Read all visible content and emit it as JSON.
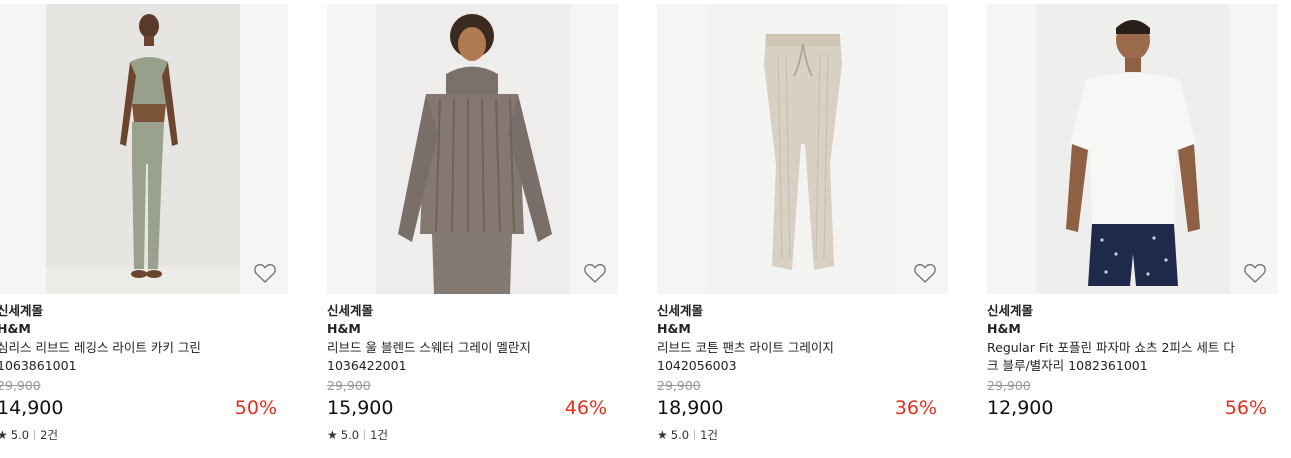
{
  "colors": {
    "discount": "#e0311f",
    "strike_price": "#999999",
    "thumb_bg": "#f5f5f5"
  },
  "products": [
    {
      "mall": "신세계몰",
      "brand": "H&M",
      "name": "심리스 리브드 레깅스 라이트 카키 그린",
      "code": "1063861001",
      "original_price": "29,900",
      "price": "14,900",
      "discount": "50%",
      "rating": "5.0",
      "reviews": "2건",
      "icon": "heart-outline-icon"
    },
    {
      "mall": "신세계몰",
      "brand": "H&M",
      "name": "리브드 울 블렌드 스웨터 그레이 멜란지",
      "code": "1036422001",
      "original_price": "29,900",
      "price": "15,900",
      "discount": "46%",
      "rating": "5.0",
      "reviews": "1건",
      "icon": "heart-outline-icon"
    },
    {
      "mall": "신세계몰",
      "brand": "H&M",
      "name": "리브드 코튼 팬츠 라이트 그레이지",
      "code": "1042056003",
      "original_price": "29,900",
      "price": "18,900",
      "discount": "36%",
      "rating": "5.0",
      "reviews": "1건",
      "icon": "heart-outline-icon"
    },
    {
      "mall": "신세계몰",
      "brand": "H&M",
      "name": "Regular Fit 포플린 파자마 쇼츠 2피스 세트 다크 블루/별자리",
      "code": "1082361001",
      "original_price": "29,900",
      "price": "12,900",
      "discount": "56%",
      "rating": "",
      "reviews": "",
      "icon": "heart-outline-icon"
    }
  ]
}
